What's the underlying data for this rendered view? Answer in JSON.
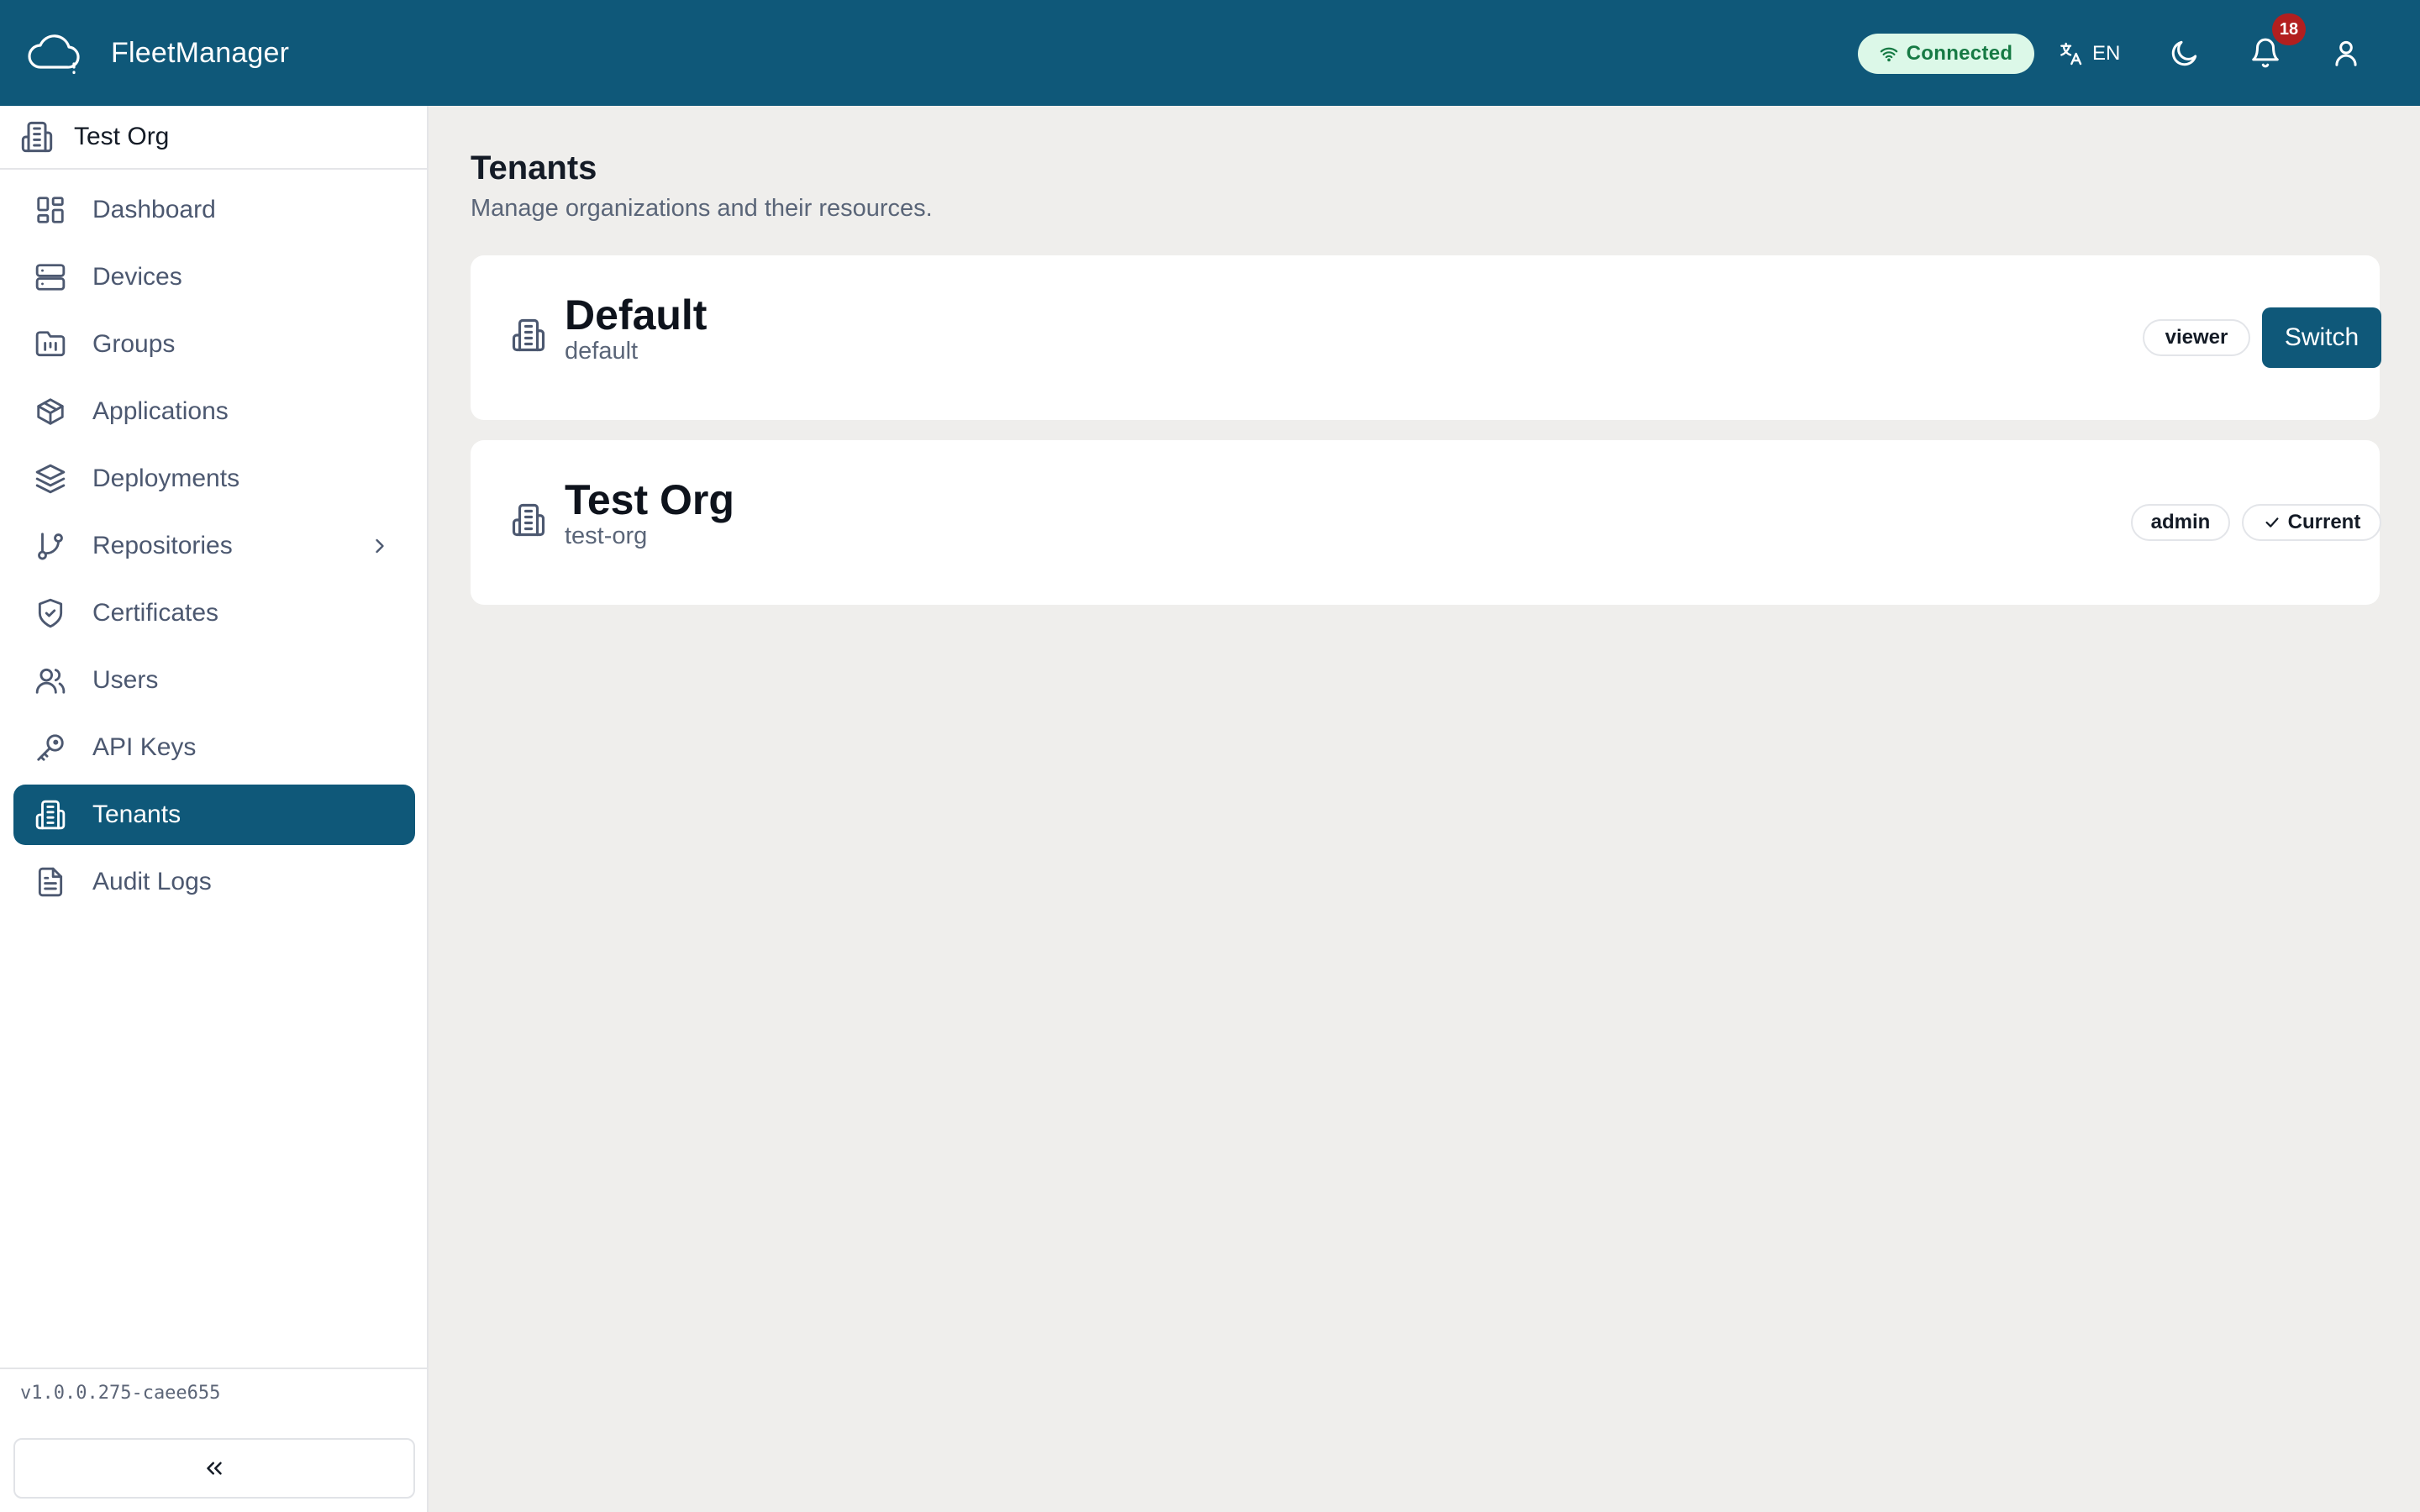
{
  "app": {
    "name": "FleetManager"
  },
  "header": {
    "connection_status": "Connected",
    "language": "EN",
    "notification_count": "18"
  },
  "sidebar": {
    "org_name": "Test Org",
    "items": [
      {
        "label": "Dashboard",
        "icon": "dashboard-icon"
      },
      {
        "label": "Devices",
        "icon": "server-icon"
      },
      {
        "label": "Groups",
        "icon": "folder-icon"
      },
      {
        "label": "Applications",
        "icon": "package-icon"
      },
      {
        "label": "Deployments",
        "icon": "layers-icon"
      },
      {
        "label": "Repositories",
        "icon": "git-branch-icon"
      },
      {
        "label": "Certificates",
        "icon": "shield-check-icon"
      },
      {
        "label": "Users",
        "icon": "users-icon"
      },
      {
        "label": "API Keys",
        "icon": "key-icon"
      },
      {
        "label": "Tenants",
        "icon": "building-icon",
        "active": true
      },
      {
        "label": "Audit Logs",
        "icon": "file-text-icon"
      }
    ],
    "version": "v1.0.0.275-caee655"
  },
  "main": {
    "title": "Tenants",
    "subtitle": "Manage organizations and their resources.",
    "tenants": [
      {
        "name": "Default",
        "slug": "default",
        "role": "viewer",
        "action": "Switch"
      },
      {
        "name": "Test Org",
        "slug": "test-org",
        "role": "admin",
        "status": "Current"
      }
    ]
  },
  "colors": {
    "header_bg": "#0f5879",
    "accent": "#0f5879",
    "connected_bg": "#dcf8e8",
    "connected_text": "#167a44",
    "notification_badge": "#b21f1f"
  }
}
